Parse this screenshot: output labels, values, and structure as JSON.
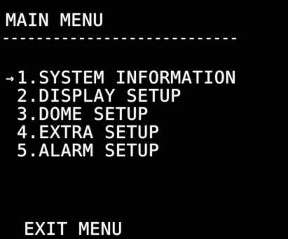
{
  "menu": {
    "title": "MAIN MENU",
    "separator": "----------------------------",
    "cursor_glyph": "→",
    "selected_index": 0,
    "items": [
      {
        "number": "1",
        "label": "SYSTEM INFORMATION",
        "text": "1.SYSTEM INFORMATION"
      },
      {
        "number": "2",
        "label": "DISPLAY SETUP",
        "text": "2.DISPLAY SETUP"
      },
      {
        "number": "3",
        "label": "DOME SETUP",
        "text": "3.DOME SETUP"
      },
      {
        "number": "4",
        "label": "EXTRA SETUP",
        "text": "4.EXTRA SETUP"
      },
      {
        "number": "5",
        "label": "ALARM SETUP",
        "text": "5.ALARM SETUP"
      }
    ],
    "exit_label": "EXIT MENU"
  },
  "colors": {
    "background": "#000000",
    "text": "#f2f2f2"
  }
}
